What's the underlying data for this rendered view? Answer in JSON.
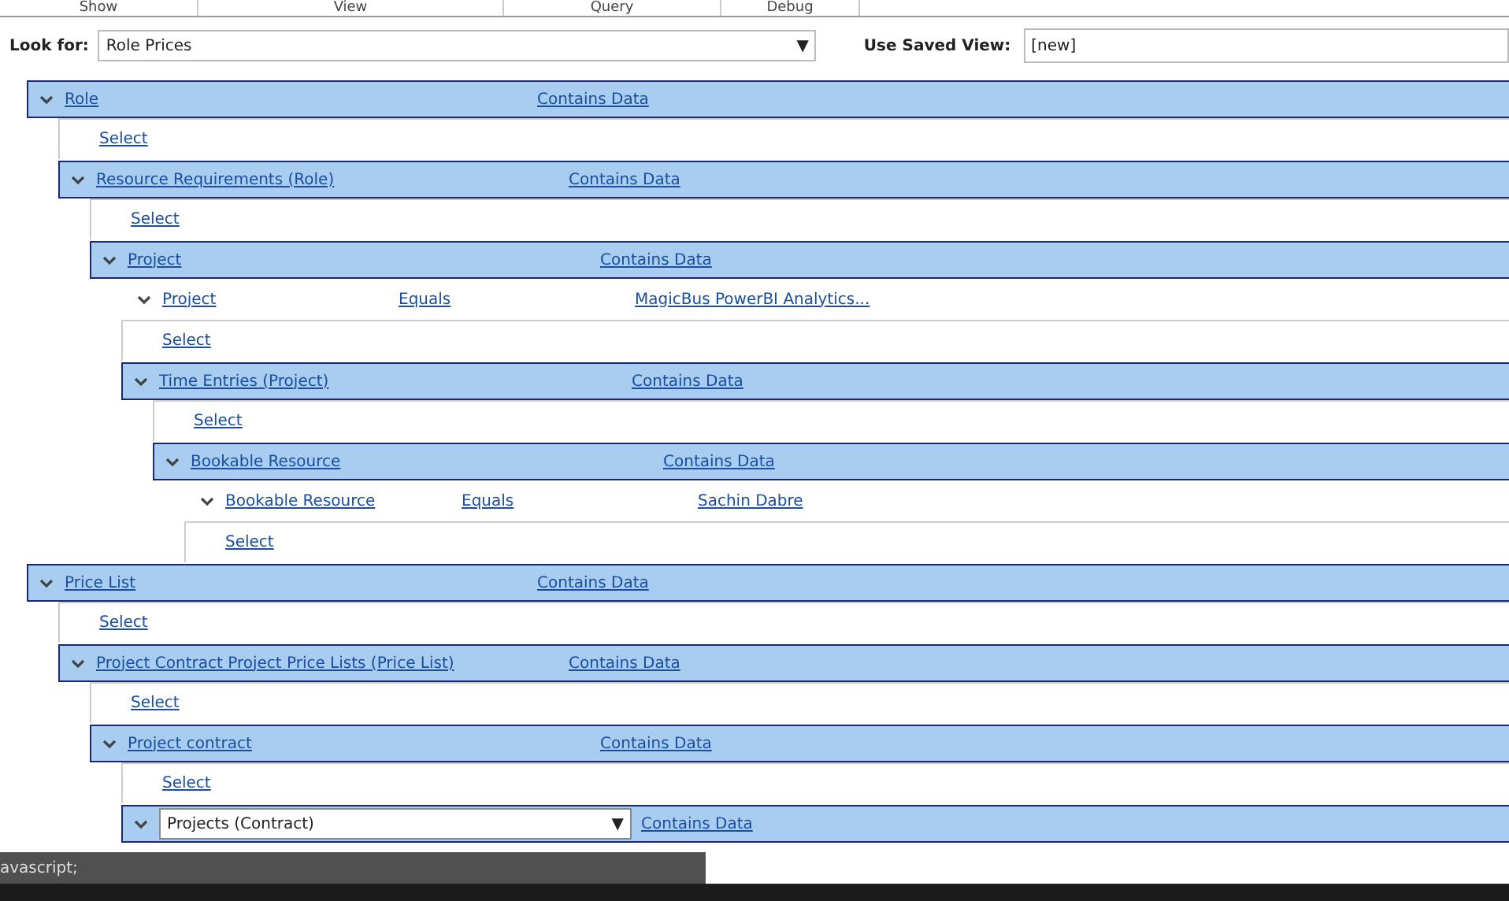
{
  "tabs": [
    {
      "label": "Show"
    },
    {
      "label": "View"
    },
    {
      "label": "Query"
    },
    {
      "label": "Debug"
    }
  ],
  "look_for": {
    "label": "Look for:",
    "value": "Role Prices",
    "arrow": "▼"
  },
  "saved_view": {
    "label": "Use Saved View:",
    "value": "[new]"
  },
  "tree": [
    {
      "kind": "entity",
      "label": "Role",
      "condition": "Contains Data",
      "expanded": true,
      "children": [
        {
          "kind": "select",
          "label": "Select"
        },
        {
          "kind": "entity",
          "label": "Resource Requirements (Role)",
          "condition": "Contains Data",
          "expanded": true,
          "children": [
            {
              "kind": "select",
              "label": "Select"
            },
            {
              "kind": "entity",
              "label": "Project",
              "condition": "Contains Data",
              "expanded": true,
              "children": [
                {
                  "kind": "condition",
                  "field": "Project",
                  "operator": "Equals",
                  "value": "MagicBus PowerBI Analytics...",
                  "expanded": true
                },
                {
                  "kind": "select",
                  "label": "Select"
                },
                {
                  "kind": "entity",
                  "label": "Time Entries (Project)",
                  "condition": "Contains Data",
                  "expanded": true,
                  "children": [
                    {
                      "kind": "select",
                      "label": "Select"
                    },
                    {
                      "kind": "entity",
                      "label": "Bookable Resource",
                      "condition": "Contains Data",
                      "expanded": true,
                      "children": [
                        {
                          "kind": "condition",
                          "field": "Bookable Resource",
                          "operator": "Equals",
                          "value": "Sachin Dabre",
                          "expanded": true
                        },
                        {
                          "kind": "select",
                          "label": "Select"
                        }
                      ]
                    }
                  ]
                }
              ]
            }
          ]
        }
      ]
    },
    {
      "kind": "entity",
      "label": "Price List",
      "condition": "Contains Data",
      "expanded": true,
      "children": [
        {
          "kind": "select",
          "label": "Select"
        },
        {
          "kind": "entity",
          "label": "Project Contract Project Price Lists (Price List)",
          "condition": "Contains Data",
          "expanded": true,
          "children": [
            {
              "kind": "select",
              "label": "Select"
            },
            {
              "kind": "entity",
              "label": "Project contract",
              "condition": "Contains Data",
              "expanded": true,
              "children": [
                {
                  "kind": "select",
                  "label": "Select"
                },
                {
                  "kind": "picker",
                  "label": "Projects (Contract)",
                  "arrow": "▼",
                  "condition": "Contains Data",
                  "expanded": true
                }
              ]
            }
          ]
        }
      ]
    }
  ],
  "status_bar": {
    "text": "avascript;"
  }
}
